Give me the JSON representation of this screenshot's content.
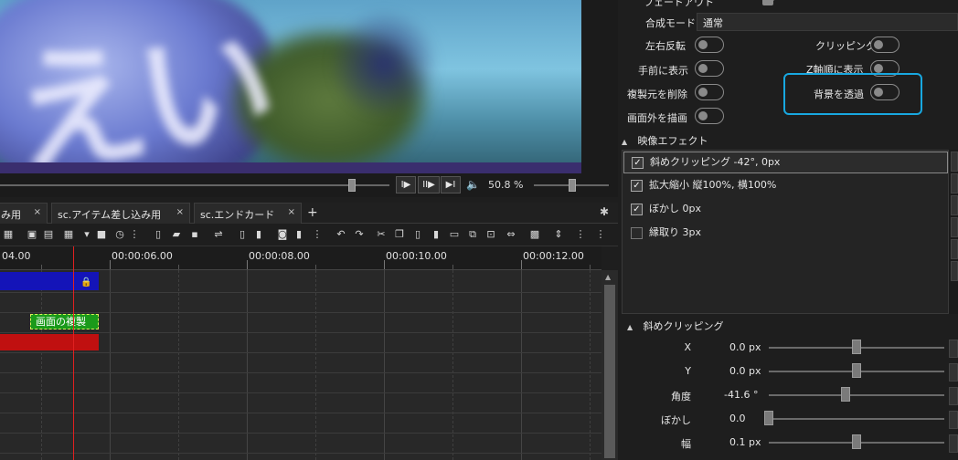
{
  "preview": {
    "overlay_text": "えい"
  },
  "transport": {
    "zoom": "50.8 %",
    "btn_step_forward": "I▶",
    "btn_play_pause": "II▶",
    "btn_next": "▶I",
    "volume_icon": "speaker-icon"
  },
  "tabs": [
    {
      "label": "み用"
    },
    {
      "label": "sc.アイテム差し込み用"
    },
    {
      "label": "sc.エンドカード"
    }
  ],
  "tab_close": "×",
  "tab_add": "+",
  "tab_settings": "✱",
  "ruler": {
    "labels": [
      "04.00",
      "00:00:06.00",
      "00:00:08.00",
      "00:00:10.00",
      "00:00:12.00"
    ]
  },
  "clips": {
    "green_label": "画面の複製",
    "lock_icon": "🔒"
  },
  "properties": {
    "top_cut_label": "フェードアウト",
    "blend_mode_label": "合成モード",
    "blend_mode_value": "通常",
    "toggles": {
      "flip_h": "左右反転",
      "clipping": "クリッピング",
      "bring_front": "手前に表示",
      "z_order": "Z軸順に表示",
      "delete_source": "複製元を削除",
      "bg_transparent": "背景を透過",
      "draw_outside": "画面外を描画"
    }
  },
  "video_effects": {
    "header": "映像エフェクト",
    "items": [
      {
        "label": "斜めクリッピング -42°, 0px",
        "checked": true,
        "selected": true
      },
      {
        "label": "拡大縮小 縦100%, 横100%",
        "checked": true,
        "selected": false
      },
      {
        "label": "ぼかし 0px",
        "checked": true,
        "selected": false
      },
      {
        "label": "縁取り 3px",
        "checked": false,
        "selected": false
      }
    ]
  },
  "diagonal_clip": {
    "header": "斜めクリッピング",
    "params": [
      {
        "label": "X",
        "value": "0.0 px",
        "slider": 0.5
      },
      {
        "label": "Y",
        "value": "0.0 px",
        "slider": 0.5
      },
      {
        "label": "角度",
        "value": "-41.6 °",
        "slider": 0.43
      },
      {
        "label": "ぼかし",
        "value": "0.0",
        "slider": 0.0
      },
      {
        "label": "幅",
        "value": "0.1 px",
        "slider": 0.5
      }
    ]
  },
  "check_mark": "✓",
  "chevron": "▲",
  "colors": {
    "highlight": "#18a8e0",
    "clip_blue": "#1414b8",
    "clip_red": "#c01010",
    "clip_green": "#1a9a1a",
    "playhead": "#e02020"
  }
}
